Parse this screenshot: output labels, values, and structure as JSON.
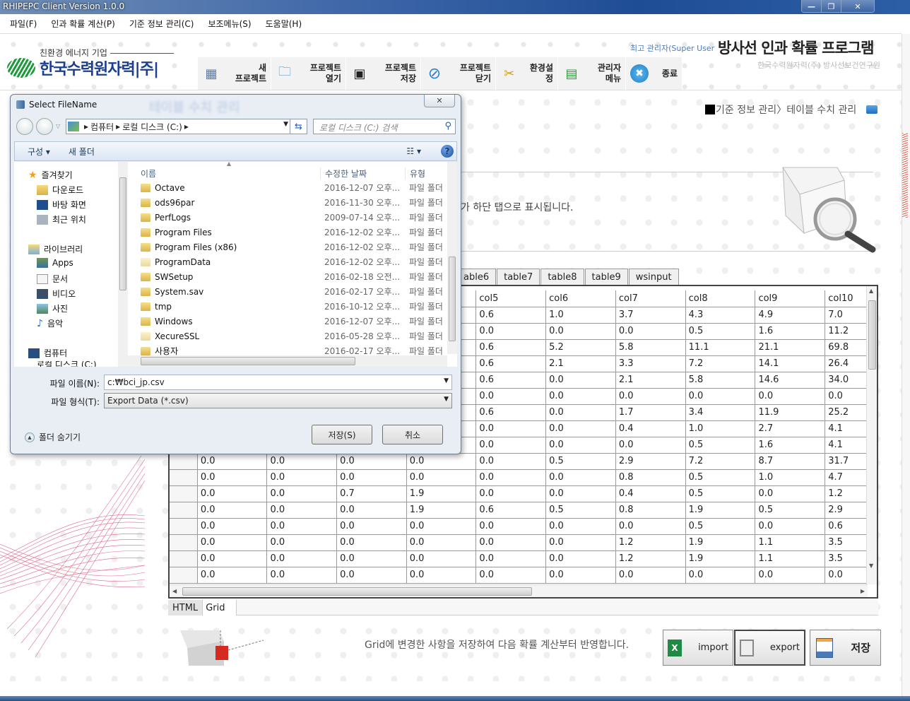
{
  "window": {
    "title": "RHIPEPC Client Version 1.0.0",
    "controls": {
      "minimize": "—",
      "maximize": "❐",
      "close": "✕"
    }
  },
  "menu": [
    "파일(F)",
    "인과 확률 계산(P)",
    "기준 정보 관리(C)",
    "보조메뉴(S)",
    "도움말(H)"
  ],
  "header": {
    "logo_tagline": "친환경 에너지 기업",
    "logo_name": "한국수력원자력|주|",
    "user": "최고 관리자(Super User",
    "app_title": "방사선 인과 확률 프로그램",
    "app_subtitle": "한국수력원자력(주) 방사선보건연구원"
  },
  "toolbar": [
    {
      "icon": "new-project-icon",
      "glyph": "▦",
      "label": "새\n프로젝트"
    },
    {
      "icon": "open-folder-icon",
      "glyph": "📂",
      "label": "프로젝트\n열기"
    },
    {
      "icon": "floppy-disk-icon",
      "glyph": "💾",
      "label": "프로젝트\n저장"
    },
    {
      "icon": "close-project-icon",
      "glyph": "⊘",
      "label": "프로젝트\n닫기"
    },
    {
      "icon": "tools-icon",
      "glyph": "✂",
      "label": "환경설정"
    },
    {
      "icon": "chart-icon",
      "glyph": "📈",
      "label": "관리자\n메뉴"
    },
    {
      "icon": "exit-icon",
      "glyph": "✖",
      "label": "종료"
    }
  ],
  "breadcrumb": {
    "parent": "기준 정보 관리",
    "separator": "〉",
    "current": "테이블 수치 관리"
  },
  "page": {
    "blurred_title": "테이블 수치 관리",
    "info_text": "가 하단 탭으로 표시됩니다.",
    "footer_text": "Grid에 변경한 사항을 저장하여 다음 확률 계산부터 반영합니다."
  },
  "table_tabs": [
    "able6",
    "table7",
    "table8",
    "table9",
    "wsinput"
  ],
  "grid": {
    "columns": [
      "col5",
      "col6",
      "col7",
      "col8",
      "col9",
      "col10"
    ],
    "visible_rows": [
      [
        "0.6",
        "1.0",
        "3.7",
        "4.3",
        "4.9",
        "7.0"
      ],
      [
        "0.0",
        "0.0",
        "0.0",
        "0.5",
        "1.6",
        "11.2"
      ],
      [
        "0.6",
        "5.2",
        "5.8",
        "11.1",
        "21.1",
        "69.8"
      ],
      [
        "0.6",
        "2.1",
        "3.3",
        "7.2",
        "14.1",
        "26.4"
      ],
      [
        "0.6",
        "0.0",
        "2.1",
        "5.8",
        "14.6",
        "34.0"
      ],
      [
        "0.0",
        "0.0",
        "0.0",
        "0.0",
        "0.0",
        "0.0"
      ],
      [
        "0.6",
        "0.0",
        "1.7",
        "3.4",
        "11.9",
        "25.2"
      ],
      [
        "0.0",
        "0.0",
        "0.4",
        "1.0",
        "2.7",
        "4.1"
      ],
      [
        "0.0",
        "0.0",
        "0.0",
        "0.5",
        "1.6",
        "4.1"
      ],
      [
        "0.0",
        "0.5",
        "2.9",
        "7.2",
        "8.7",
        "31.7"
      ],
      [
        "0.0",
        "0.0",
        "0.8",
        "0.5",
        "1.0",
        "4.7"
      ],
      [
        "0.0",
        "0.0",
        "0.4",
        "0.5",
        "0.0",
        "1.2"
      ],
      [
        "0.6",
        "0.5",
        "0.8",
        "1.9",
        "0.5",
        "2.9"
      ],
      [
        "0.0",
        "0.0",
        "0.0",
        "0.5",
        "0.0",
        "0.6"
      ],
      [
        "0.0",
        "0.0",
        "1.2",
        "1.9",
        "1.1",
        "3.5"
      ],
      [
        "0.0",
        "0.0",
        "1.2",
        "1.9",
        "1.1",
        "3.5"
      ],
      [
        "0.0",
        "0.0",
        "0.0",
        "0.0",
        "0.0",
        "0.0"
      ]
    ],
    "left_rows": [
      [
        "0.0",
        "0.0",
        "0.0",
        "0.0"
      ],
      [
        "0.0",
        "0.0",
        "0.0",
        "0.0"
      ],
      [
        "0.0",
        "0.0",
        "0.7",
        "1.9"
      ],
      [
        "0.0",
        "0.0",
        "0.0",
        "1.9"
      ],
      [
        "0.0",
        "0.0",
        "0.0",
        "0.0"
      ],
      [
        "0.0",
        "0.0",
        "0.0",
        "0.0"
      ],
      [
        "0.0",
        "0.0",
        "0.0",
        "0.0"
      ],
      [
        "0.0",
        "0.0",
        "0.0",
        "0.0"
      ]
    ]
  },
  "view_tabs": [
    "HTML",
    "Grid"
  ],
  "actions": {
    "import": "import",
    "export": "export",
    "save": "저장"
  },
  "dialog": {
    "title": "Select FileName",
    "close": "✕",
    "path": [
      "컴퓨터",
      "로컬 디스크 (C:)"
    ],
    "search_placeholder": "로컬 디스크 (C:) 검색",
    "organize": "구성 ▾",
    "new_folder": "새 폴더",
    "nav": {
      "favorites": "즐겨찾기",
      "favorites_items": [
        "다운로드",
        "바탕 화면",
        "최근 위치"
      ],
      "libraries": "라이브러리",
      "library_items": [
        "Apps",
        "문서",
        "비디오",
        "사진",
        "음악"
      ],
      "computer": "컴퓨터",
      "computer_items": [
        "로컬 디스크 (C:)"
      ]
    },
    "columns": {
      "name": "이름",
      "date": "수정한 날짜",
      "type": "유형"
    },
    "files": [
      {
        "name": "Octave",
        "date": "2016-12-07 오후...",
        "type": "파일 폴더",
        "light": false
      },
      {
        "name": "ods96par",
        "date": "2016-11-30 오후...",
        "type": "파일 폴더",
        "light": false
      },
      {
        "name": "PerfLogs",
        "date": "2009-07-14 오후...",
        "type": "파일 폴더",
        "light": false
      },
      {
        "name": "Program Files",
        "date": "2016-12-02 오후...",
        "type": "파일 폴더",
        "light": false
      },
      {
        "name": "Program Files (x86)",
        "date": "2016-12-02 오후...",
        "type": "파일 폴더",
        "light": false
      },
      {
        "name": "ProgramData",
        "date": "2016-12-02 오후...",
        "type": "파일 폴더",
        "light": true
      },
      {
        "name": "SWSetup",
        "date": "2016-02-18 오전...",
        "type": "파일 폴더",
        "light": false
      },
      {
        "name": "System.sav",
        "date": "2016-02-17 오후...",
        "type": "파일 폴더",
        "light": false
      },
      {
        "name": "tmp",
        "date": "2016-10-12 오후...",
        "type": "파일 폴더",
        "light": false
      },
      {
        "name": "Windows",
        "date": "2016-12-07 오후...",
        "type": "파일 폴더",
        "light": false
      },
      {
        "name": "XecureSSL",
        "date": "2016-05-28 오후...",
        "type": "파일 폴더",
        "light": true
      },
      {
        "name": "사용자",
        "date": "2016-02-17 오후...",
        "type": "파일 폴더",
        "light": false
      }
    ],
    "filename_label": "파일 이름(N):",
    "filename_value": "c:₩bci_jp.csv",
    "filetype_label": "파일 형식(T):",
    "filetype_value": "Export Data (*.csv)",
    "hide_folders": "폴더 숨기기",
    "save_button": "저장(S)",
    "cancel_button": "취소"
  }
}
